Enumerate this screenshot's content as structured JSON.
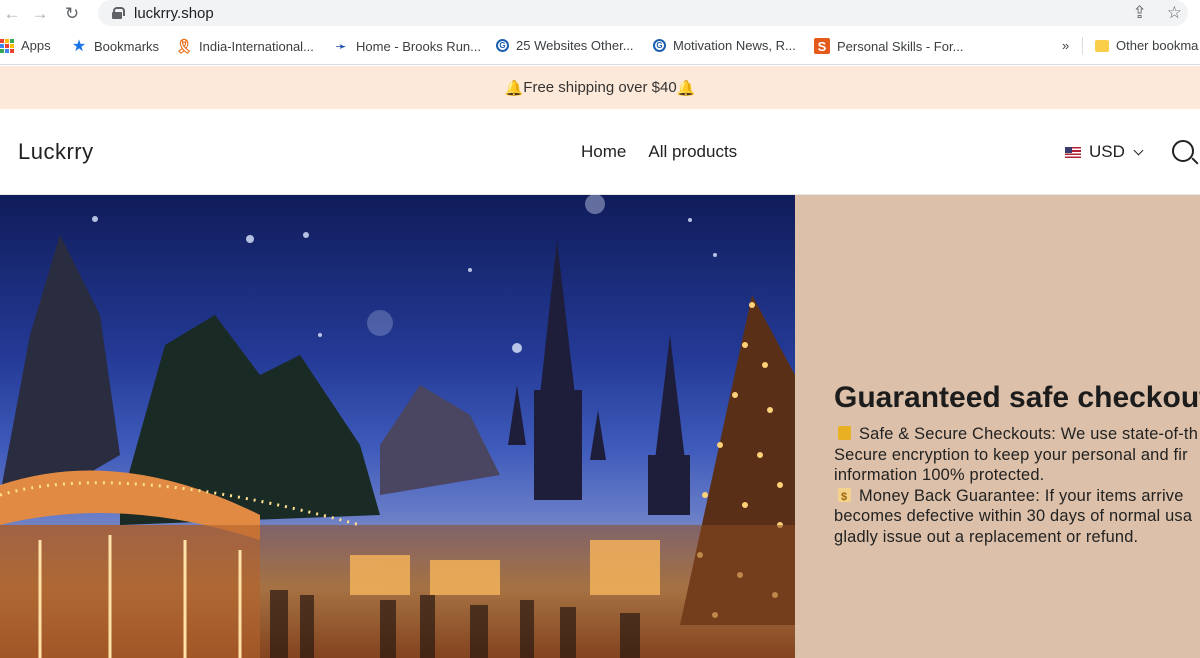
{
  "browser": {
    "url": "luckrry.shop",
    "bookmarks": [
      {
        "label": "Apps",
        "icon": "apps-grid-icon"
      },
      {
        "label": "Bookmarks",
        "icon": "star-icon"
      },
      {
        "label": "India-International...",
        "icon": "ribbon-icon"
      },
      {
        "label": "Home - Brooks Run...",
        "icon": "brooks-icon"
      },
      {
        "label": "25 Websites Other...",
        "icon": "circle-logo-icon"
      },
      {
        "label": "Motivation News, R...",
        "icon": "circle-logo-icon"
      },
      {
        "label": "Personal Skills - For...",
        "icon": "s-logo-icon"
      }
    ],
    "overflow_label": "»",
    "other_bookmarks": "Other bookma"
  },
  "announcement": {
    "text": "Free shipping over $40"
  },
  "store": {
    "logo": "Luckrry",
    "nav": [
      "Home",
      "All products"
    ],
    "currency": "USD"
  },
  "hero": {
    "title": "Guaranteed safe checkout",
    "body_lines": [
      "Safe & Secure Checkouts: We use state-of-th",
      "Secure encryption to keep your personal and fir",
      "information 100% protected.",
      "Money Back Guarantee: If your items arrive",
      "becomes defective within 30 days of normal usa",
      "gladly issue out a replacement or refund."
    ]
  },
  "colors": {
    "announcement_bg": "#fde9d9",
    "hero_panel_bg": "#dcc0a9",
    "bell": "#f5b41c"
  }
}
